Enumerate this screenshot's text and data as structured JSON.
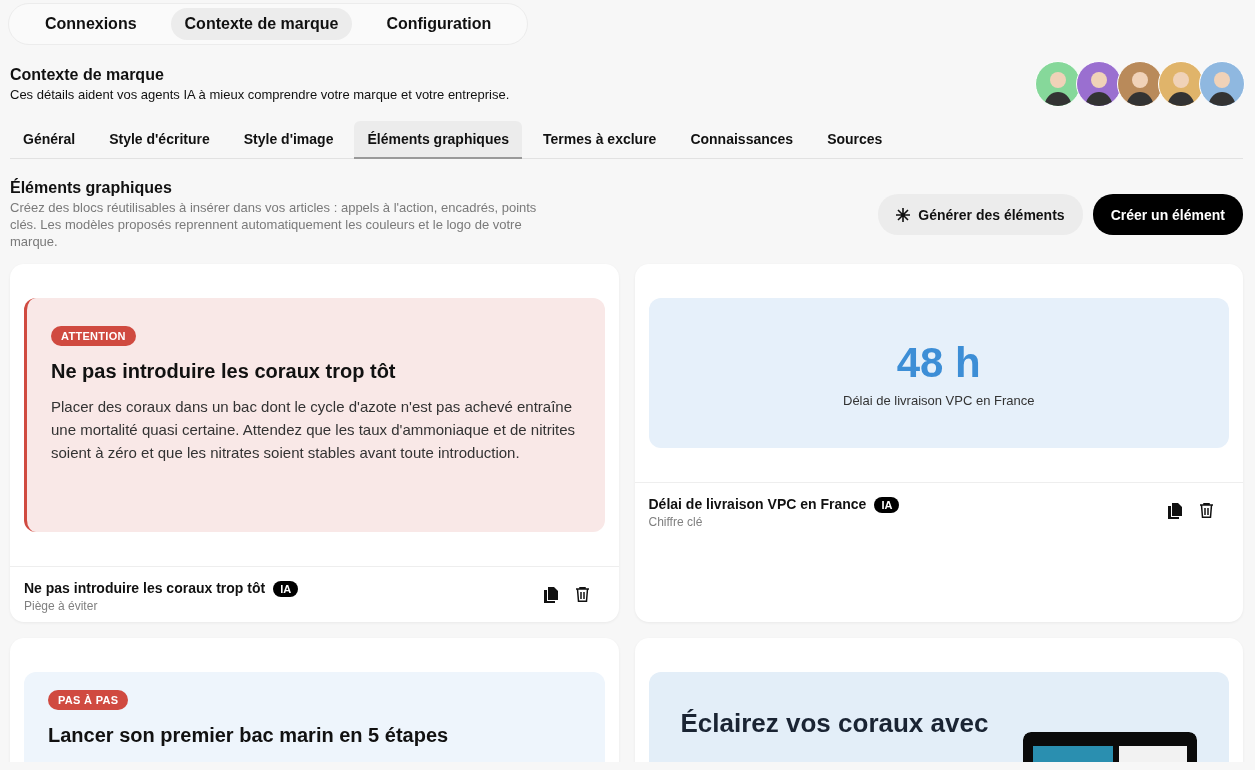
{
  "top_tabs": [
    {
      "label": "Connexions",
      "selected": false
    },
    {
      "label": "Contexte de marque",
      "selected": true
    },
    {
      "label": "Configuration",
      "selected": false
    }
  ],
  "header": {
    "title": "Contexte de marque",
    "subtitle": "Ces détails aident vos agents IA à mieux comprendre votre marque et votre entreprise."
  },
  "avatars": [
    {
      "color": "#86d89a"
    },
    {
      "color": "#9a6fd0"
    },
    {
      "color": "#b98a5a"
    },
    {
      "color": "#e0b46a"
    },
    {
      "color": "#8fb8e0"
    }
  ],
  "sub_tabs": [
    {
      "label": "Général",
      "selected": false
    },
    {
      "label": "Style d'écriture",
      "selected": false
    },
    {
      "label": "Style d'image",
      "selected": false
    },
    {
      "label": "Éléments graphiques",
      "selected": true
    },
    {
      "label": "Termes à exclure",
      "selected": false
    },
    {
      "label": "Connaissances",
      "selected": false
    },
    {
      "label": "Sources",
      "selected": false
    }
  ],
  "section": {
    "title": "Éléments graphiques",
    "description": "Créez des blocs réutilisables à insérer dans vos articles : appels à l'action, encadrés, points clés. Les modèles proposés reprennent automatiquement les couleurs et le logo de votre marque."
  },
  "actions": [
    {
      "label": "Générer des éléments",
      "kind": "secondary"
    },
    {
      "label": "Créer un élément",
      "kind": "primary"
    }
  ],
  "cards": [
    {
      "kind": "callout",
      "badge": "ATTENTION",
      "title": "Ne pas introduire les coraux trop tôt",
      "body": "Placer des coraux dans un bac dont le cycle d'azote n'est pas achevé entraîne une mortalité quasi certaine. Attendez que les taux d'ammoniaque et de nitrites soient à zéro et que les nitrates soient stables avant toute introduction.",
      "footer": {
        "name": "Ne pas introduire les coraux trop tôt",
        "tag": "IA",
        "type": "Piège à éviter"
      }
    },
    {
      "kind": "stat",
      "value": "48 h",
      "caption": "Délai de livraison VPC en France",
      "footer": {
        "name": "Délai de livraison VPC en France",
        "tag": "IA",
        "type": "Chiffre clé"
      }
    },
    {
      "kind": "steps",
      "badge": "PAS À PAS",
      "title": "Lancer son premier bac marin en 5 étapes"
    },
    {
      "kind": "banner",
      "title": "Éclairez vos coraux avec"
    }
  ]
}
